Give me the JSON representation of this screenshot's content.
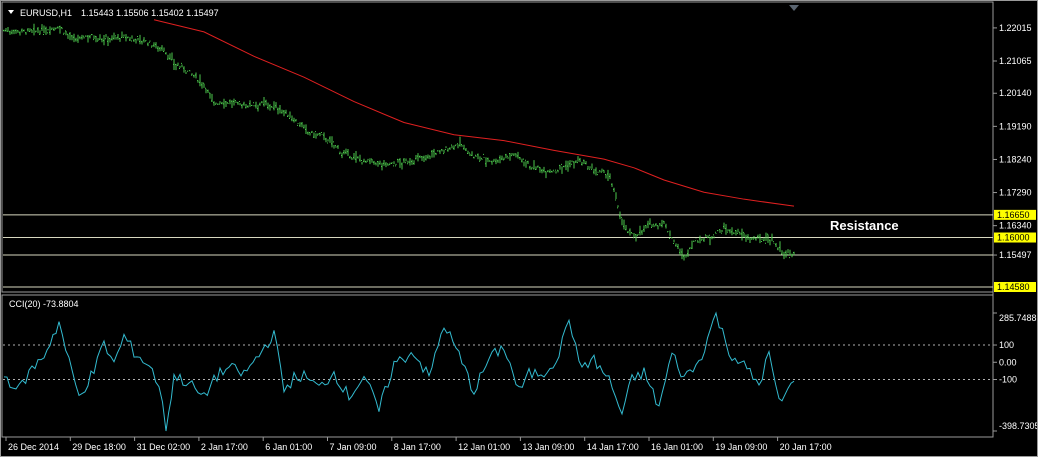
{
  "header": {
    "symbol_timeframe": "EURUSD,H1",
    "ohlc": "1.15443 1.15506 1.15402 1.15497"
  },
  "indicator": {
    "label": "CCI(20) -73.8804",
    "levels": [
      "285.7488",
      "100",
      "0.00",
      "-100",
      "-398.7305"
    ]
  },
  "price_axis": {
    "ticks": [
      "1.22015",
      "1.21065",
      "1.20140",
      "1.19190",
      "1.18240",
      "1.17290",
      "1.16340",
      "1.15497"
    ],
    "tagged_levels": [
      "1.16650",
      "1.16000",
      "1.14580"
    ]
  },
  "annotation": {
    "resistance": "Resistance"
  },
  "time_axis": [
    "26 Dec 2014",
    "29 Dec 18:00",
    "31 Dec 02:00",
    "2 Jan 17:00",
    "6 Jan 01:00",
    "7 Jan 09:00",
    "8 Jan 17:00",
    "12 Jan 01:00",
    "13 Jan 09:00",
    "14 Jan 17:00",
    "16 Jan 01:00",
    "19 Jan 09:00",
    "20 Jan 17:00"
  ],
  "colors": {
    "candles": "#4cc84c",
    "moving_average": "#e02020",
    "cci_line": "#33bbd0",
    "tag_bg": "#ffff00",
    "frame": "#9a9a9a"
  },
  "chart_data": {
    "type": "line",
    "main": {
      "ylim": [
        1.1458,
        1.225
      ],
      "horizontal_lines": [
        1.1665,
        1.16,
        1.15497,
        1.1458
      ],
      "price_x": [
        0,
        30,
        55,
        70,
        85,
        100,
        120,
        140,
        160,
        170,
        185,
        200,
        210,
        220,
        240,
        260,
        275,
        290,
        305,
        320,
        340,
        360,
        380,
        400,
        420,
        440,
        455,
        470,
        490,
        510,
        530,
        550,
        565,
        575,
        590,
        605,
        615,
        622,
        630,
        645,
        660,
        672,
        680,
        690,
        705,
        720,
        735,
        750,
        765,
        780,
        790
      ],
      "price_y": [
        1.2195,
        1.219,
        1.2205,
        1.2165,
        1.218,
        1.217,
        1.2175,
        1.2165,
        1.214,
        1.21,
        1.2075,
        1.204,
        1.1985,
        1.199,
        1.198,
        1.1985,
        1.197,
        1.194,
        1.19,
        1.189,
        1.184,
        1.182,
        1.181,
        1.1815,
        1.183,
        1.185,
        1.187,
        1.183,
        1.182,
        1.184,
        1.18,
        1.179,
        1.181,
        1.182,
        1.179,
        1.178,
        1.168,
        1.162,
        1.1605,
        1.1635,
        1.164,
        1.158,
        1.154,
        1.159,
        1.16,
        1.1625,
        1.161,
        1.1595,
        1.16,
        1.1555,
        1.155
      ],
      "ma_x": [
        150,
        200,
        250,
        300,
        350,
        400,
        450,
        500,
        550,
        600,
        630,
        660,
        700,
        740,
        790
      ],
      "ma_y": [
        1.2225,
        1.219,
        1.212,
        1.206,
        1.199,
        1.193,
        1.1895,
        1.1878,
        1.185,
        1.1825,
        1.18,
        1.1765,
        1.173,
        1.171,
        1.169
      ]
    },
    "cci": {
      "ylim": [
        -398.7305,
        285.7488
      ],
      "levels": [
        100,
        -100
      ],
      "x": [
        0,
        15,
        25,
        40,
        55,
        65,
        75,
        90,
        100,
        110,
        120,
        130,
        145,
        155,
        162,
        170,
        185,
        200,
        210,
        225,
        240,
        255,
        270,
        280,
        290,
        300,
        315,
        330,
        345,
        360,
        375,
        390,
        410,
        425,
        440,
        455,
        470,
        485,
        500,
        515,
        525,
        540,
        555,
        565,
        575,
        590,
        605,
        618,
        628,
        640,
        655,
        668,
        680,
        695,
        712,
        725,
        740,
        755,
        765,
        775,
        790
      ],
      "y": [
        -80,
        -160,
        -60,
        40,
        230,
        0,
        -200,
        -50,
        110,
        -10,
        150,
        60,
        -20,
        -130,
        -390,
        -80,
        -120,
        -210,
        -90,
        -30,
        -70,
        40,
        170,
        -160,
        -90,
        -80,
        -150,
        -60,
        -200,
        -80,
        -280,
        -10,
        60,
        -90,
        220,
        40,
        -170,
        20,
        90,
        -170,
        -70,
        -60,
        40,
        270,
        -20,
        10,
        -100,
        -300,
        -100,
        -60,
        -260,
        50,
        -90,
        0,
        280,
        60,
        -20,
        -130,
        50,
        -240,
        -110
      ]
    }
  }
}
